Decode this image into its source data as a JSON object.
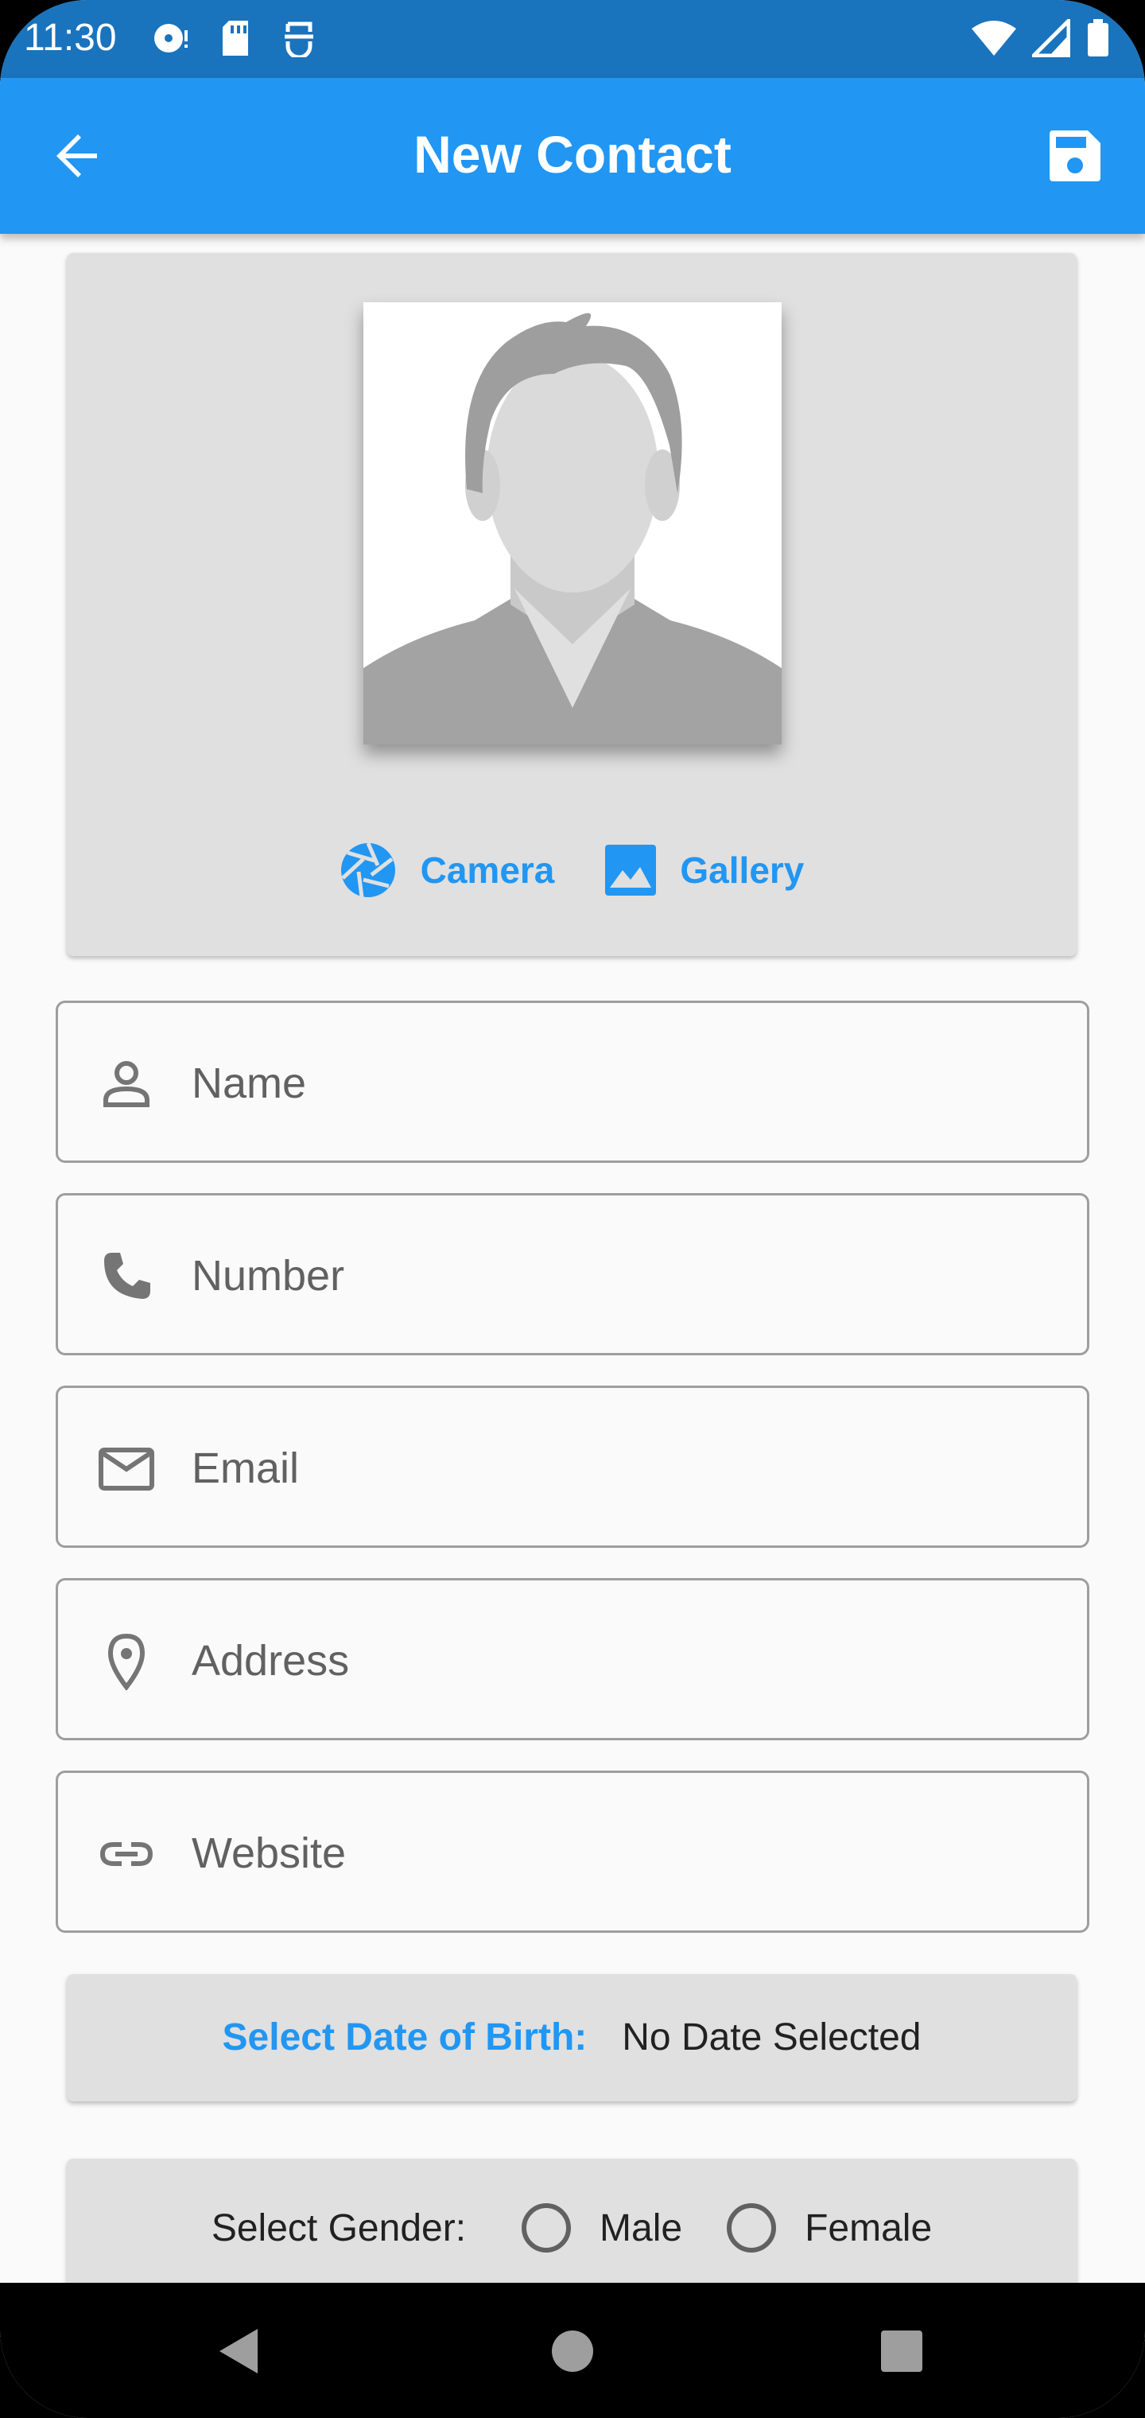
{
  "status_bar": {
    "time": "11:30",
    "icons": [
      "disc-icon",
      "sd-card-icon",
      "accessibility-icon",
      "wifi-icon",
      "signal-icon",
      "battery-icon"
    ]
  },
  "app_bar": {
    "title": "New Contact",
    "back_icon": "arrow-back-icon",
    "save_icon": "save-icon"
  },
  "photo": {
    "camera_label": "Camera",
    "gallery_label": "Gallery"
  },
  "fields": {
    "name": {
      "placeholder": "Name",
      "value": ""
    },
    "number": {
      "placeholder": "Number",
      "value": ""
    },
    "email": {
      "placeholder": "Email",
      "value": ""
    },
    "address": {
      "placeholder": "Address",
      "value": ""
    },
    "website": {
      "placeholder": "Website",
      "value": ""
    }
  },
  "dob": {
    "label": "Select Date of Birth:",
    "value": "No Date Selected"
  },
  "gender": {
    "label": "Select Gender:",
    "options": [
      "Male",
      "Female"
    ]
  },
  "colors": {
    "primary": "#2196f3",
    "status_bar": "#1a73bd",
    "card": "#e0e0e0"
  }
}
